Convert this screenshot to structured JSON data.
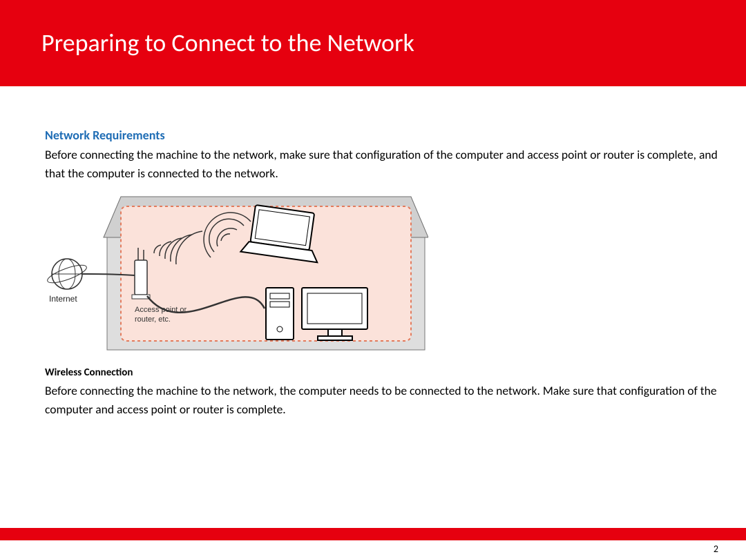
{
  "header": {
    "title": "Preparing to Connect to the Network"
  },
  "section": {
    "heading": "Network Requirements",
    "intro": "Before connecting the machine to the network, make sure that configuration of the computer and access point or router is complete, and that the computer is connected to the network."
  },
  "diagram": {
    "internet_label": "Internet",
    "router_label_line1": "Access point or",
    "router_label_line2": "router, etc."
  },
  "wireless": {
    "heading": "Wireless Connection",
    "body": "Before connecting the machine to the network, the computer needs to be connected to the network. Make sure that configuration of the computer and access point or router is complete."
  },
  "footer": {
    "page_number": "2"
  }
}
